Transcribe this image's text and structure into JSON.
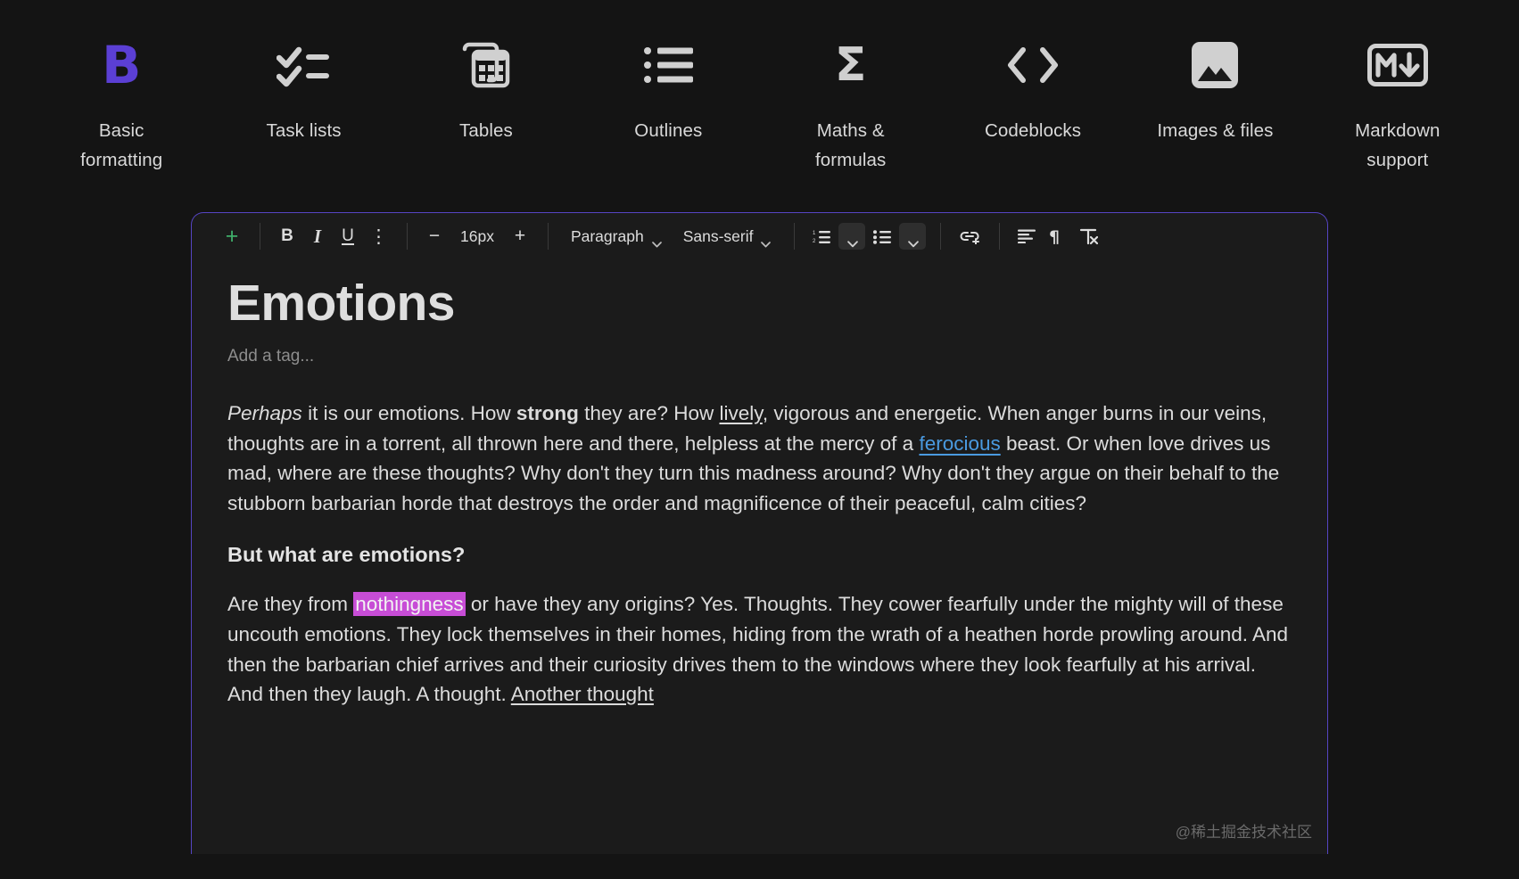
{
  "features": [
    {
      "label": "Basic formatting",
      "icon": "bold-b-icon",
      "accent": "#5b3fd4"
    },
    {
      "label": "Task lists",
      "icon": "checklist-icon"
    },
    {
      "label": "Tables",
      "icon": "table-icon"
    },
    {
      "label": "Outlines",
      "icon": "bullet-outline-icon"
    },
    {
      "label": "Maths & formulas",
      "icon": "sigma-icon"
    },
    {
      "label": "Codeblocks",
      "icon": "code-brackets-icon"
    },
    {
      "label": "Images & files",
      "icon": "image-icon"
    },
    {
      "label": "Markdown support",
      "icon": "markdown-icon"
    }
  ],
  "toolbar": {
    "insert_label": "+",
    "bold_label": "B",
    "italic_label": "I",
    "underline_label": "U",
    "more_label": "⋮",
    "font_size_decrease": "−",
    "font_size_value": "16px",
    "font_size_increase": "+",
    "block_type": "Paragraph",
    "font_family": "Sans-serif",
    "ordered_list_icon": "ordered-list-icon",
    "ordered_list_chevron": "chevron-down-icon",
    "bullet_list_icon": "bullet-list-icon",
    "bullet_list_chevron": "chevron-down-icon",
    "link_icon": "link-icon",
    "align_icon": "align-left-icon",
    "direction_icon": "text-direction-icon",
    "clear_format_icon": "clear-formatting-icon"
  },
  "document": {
    "title": "Emotions",
    "tag_placeholder": "Add a tag...",
    "paragraph1": {
      "italic_lead": "Perhaps",
      "part1": " it is our emotions. How ",
      "bold": "strong",
      "part2": " they are? How ",
      "underline": "lively",
      "part3": ", vigorous and energetic. When anger burns in our veins, thoughts are in a torrent, all thrown here and there, helpless at the mercy of a ",
      "link": "ferocious",
      "part4": " beast. Or when love drives us mad, where are these thoughts? Why don't they turn this madness around? Why don't they argue on their behalf to the stubborn barbarian horde that destroys the order and magnificence of their peaceful, calm cities?"
    },
    "heading2": "But what are emotions?",
    "paragraph2": {
      "part1": "Are they from ",
      "highlight": "nothingness",
      "part2": " or have they any origins? Yes. Thoughts. They cower fearfully under the mighty will of these uncouth emotions. They lock themselves in their homes, hiding from the wrath of a heathen horde prowling around. And then the barbarian chief arrives and their curiosity drives them to the windows where they look fearfully at his arrival. And then they laugh. A thought. ",
      "underline_tail": "Another thought "
    }
  },
  "watermark": "@稀土掘金技术社区",
  "colors": {
    "background": "#141414",
    "panel": "#1b1b1b",
    "panel_border": "#5645c4",
    "accent_purple": "#5b3fd4",
    "accent_green": "#3fae6a",
    "link_blue": "#4a9ae0",
    "highlight_magenta": "#c74dd6"
  }
}
